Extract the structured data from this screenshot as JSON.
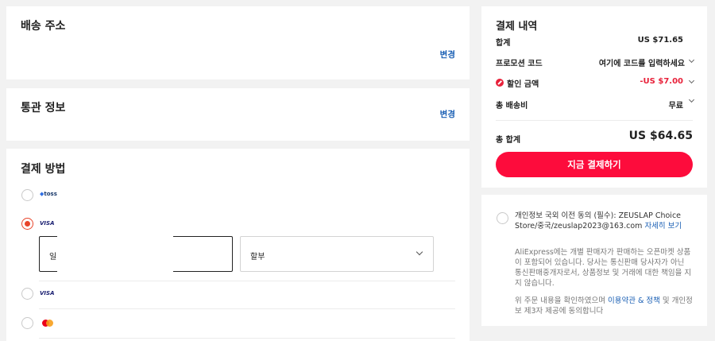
{
  "shipping": {
    "title": "배송 주소",
    "change": "변경"
  },
  "customs": {
    "title": "통관 정보",
    "change": "변경"
  },
  "payment": {
    "title": "결제 방법",
    "methods": [
      {
        "logo": "toss",
        "selected": false
      },
      {
        "logo": "VISA",
        "selected": true
      },
      {
        "logo": "VISA",
        "selected": false
      },
      {
        "logo": "mastercard",
        "selected": false
      }
    ],
    "card_field_value": "일",
    "installment_label": "할부"
  },
  "summary": {
    "title": "결제 내역",
    "total_label": "합계",
    "total_value": "US $71.65",
    "promo_label": "프로모션 코드",
    "promo_placeholder": "여기에 코드를 입력하세요",
    "discount_label": "할인 금액",
    "discount_value": "-US $7.00",
    "shipping_label": "총 배송비",
    "shipping_value": "무료",
    "grand_label": "총 합계",
    "grand_value": "US $64.65",
    "pay_button": "지금 결제하기"
  },
  "consent": {
    "text": "개인정보 국외 이전 동의 (필수): ZEUSLAP Choice Store/중국/zeuslap2023@163.com",
    "link": "자세히 보기",
    "notice": "AliExpress에는 개별 판매자가 판매하는 오픈마켓 상품이 포함되어 있습니다. 당사는 통신판매 당사자가 아닌 통신판매중개자로서, 상품정보 및 거래에 대한 책임을 지지 않습니다.",
    "agree_prefix": "위 주문 내용을 확인하였으며",
    "agree_link": "이용약관 & 정책",
    "agree_suffix": "및 개인정보 제3자 제공에 동의합니다"
  },
  "colors": {
    "accent": "#fd0c3c",
    "link": "#1a5fb4",
    "discount": "#e8213a",
    "background": "#f2f2f2"
  }
}
